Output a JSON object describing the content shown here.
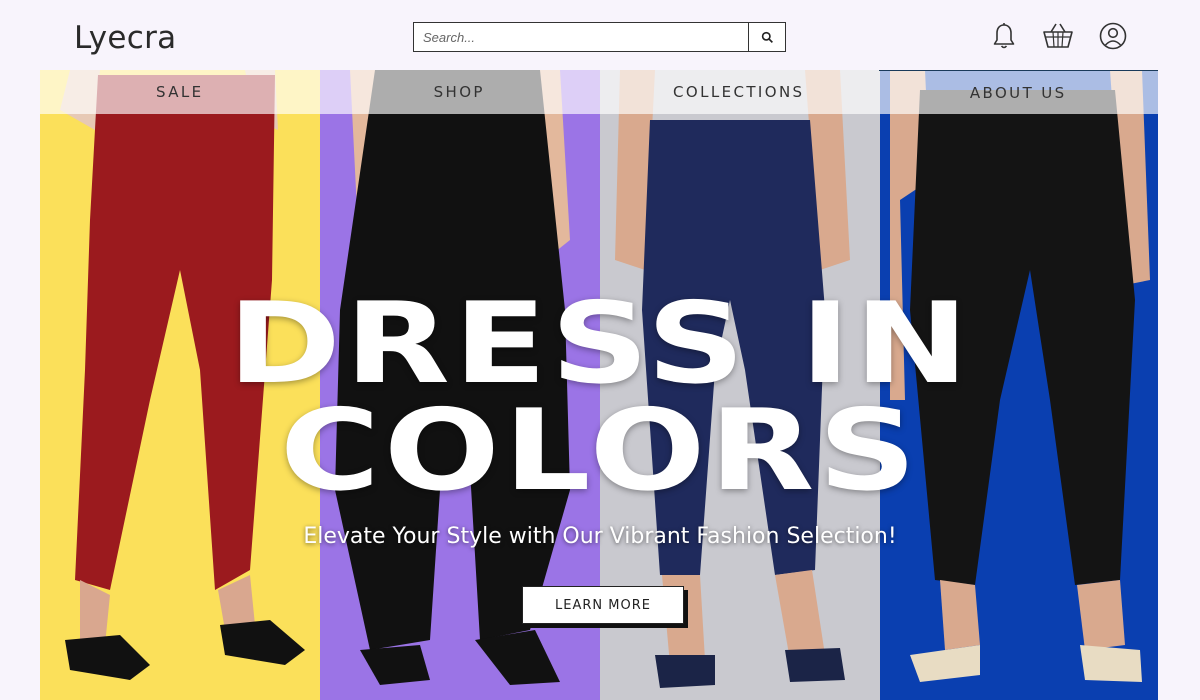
{
  "brand": {
    "name": "Lyecra"
  },
  "search": {
    "placeholder": "Search...",
    "icon": "search-icon"
  },
  "header_icons": [
    "bell-icon",
    "basket-icon",
    "user-icon"
  ],
  "nav": {
    "items": [
      {
        "label": "SALE"
      },
      {
        "label": "SHOP"
      },
      {
        "label": "COLLECTIONS"
      },
      {
        "label": "ABOUT US"
      }
    ]
  },
  "hero": {
    "headline_line1": "DRESS IN",
    "headline_line2": "COLORS",
    "subtitle": "Elevate Your Style with Our Vibrant Fashion Selection!",
    "cta_label": "LEARN MORE",
    "panels": [
      {
        "bg": "#fbe05a",
        "pants": "#9b1a1e",
        "name": "red pants"
      },
      {
        "bg": "#9b74e6",
        "pants": "#111111",
        "name": "black harem pants"
      },
      {
        "bg": "#c9c9cf",
        "pants": "#1f2a5c",
        "name": "navy pants"
      },
      {
        "bg": "#0a3fb0",
        "pants": "#141414",
        "name": "black straight pants"
      }
    ]
  }
}
